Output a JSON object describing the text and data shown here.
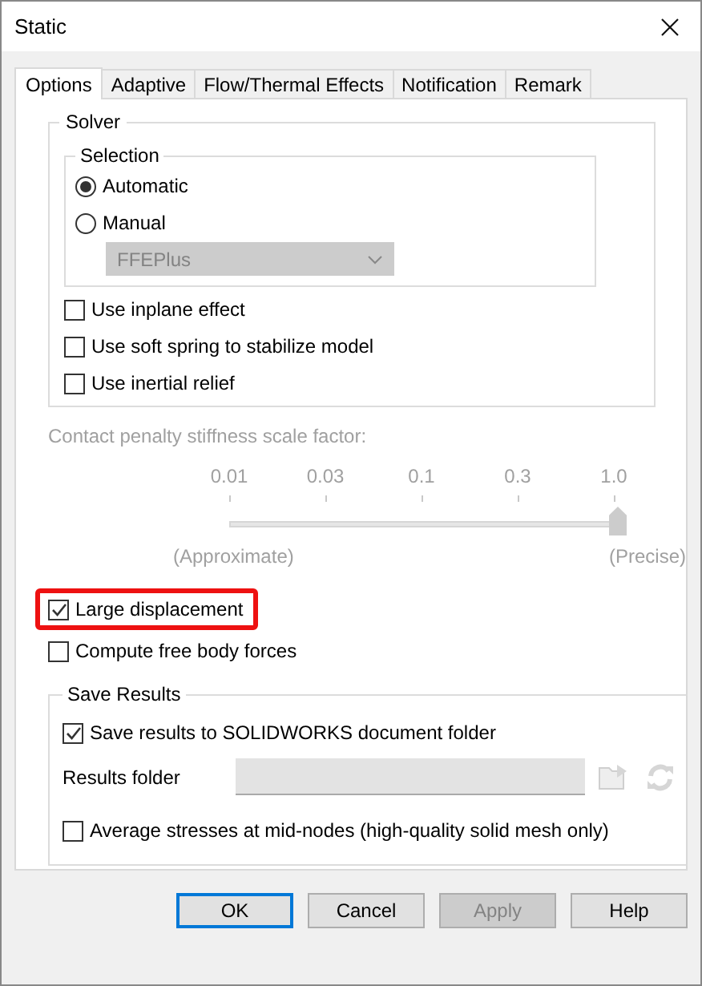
{
  "window": {
    "title": "Static"
  },
  "tabs": [
    {
      "label": "Options",
      "selected": true
    },
    {
      "label": "Adaptive",
      "selected": false
    },
    {
      "label": "Flow/Thermal Effects",
      "selected": false
    },
    {
      "label": "Notification",
      "selected": false
    },
    {
      "label": "Remark",
      "selected": false
    }
  ],
  "solver": {
    "label": "Solver",
    "selection": {
      "label": "Selection",
      "options": [
        {
          "label": "Automatic",
          "selected": true
        },
        {
          "label": "Manual",
          "selected": false
        }
      ],
      "dropdown": {
        "value": "FFEPlus",
        "disabled": true
      }
    },
    "checkboxes": [
      {
        "label": "Use inplane effect",
        "checked": false
      },
      {
        "label": "Use soft spring to stabilize model",
        "checked": false
      },
      {
        "label": "Use inertial relief",
        "checked": false
      }
    ]
  },
  "contact_penalty": {
    "label": "Contact penalty stiffness scale factor:",
    "disabled": true,
    "ticks": [
      "0.01",
      "0.03",
      "0.1",
      "0.3",
      "1.0"
    ],
    "level": 1,
    "min_label": "(Approximate)",
    "max_label": "(Precise)"
  },
  "options": [
    {
      "label": "Large displacement",
      "checked": true,
      "highlighted": true
    },
    {
      "label": "Compute free body forces",
      "checked": false,
      "highlighted": false
    }
  ],
  "save_results": {
    "label": "Save Results",
    "save_to_document_folder": {
      "label": "Save results to SOLIDWORKS document folder",
      "checked": true
    },
    "results_folder": {
      "label": "Results folder",
      "disabled": true
    },
    "average_stresses": {
      "label": "Average stresses at mid-nodes (high-quality solid mesh only)",
      "checked": false
    }
  },
  "buttons": [
    {
      "label": "OK",
      "kind": "default",
      "disabled": false
    },
    {
      "label": "Cancel",
      "kind": "normal",
      "disabled": false
    },
    {
      "label": "Apply",
      "kind": "normal",
      "disabled": true
    },
    {
      "label": "Help",
      "kind": "normal",
      "disabled": false
    }
  ]
}
